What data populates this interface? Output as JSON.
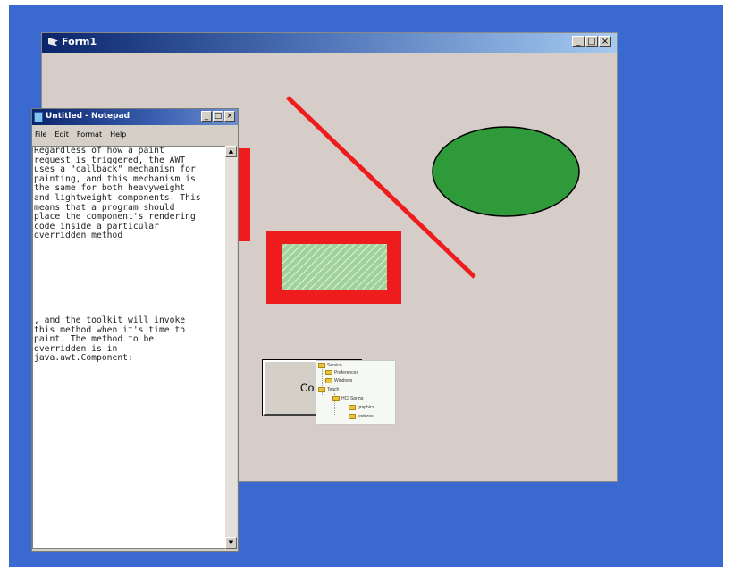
{
  "form1": {
    "title": "Form1",
    "buttons": {
      "minimize": "_",
      "maximize": "□",
      "close": "×"
    },
    "command_button_label": "Co",
    "shape_colors": {
      "red": "#ee1c1c",
      "green": "#2e9a3a",
      "hatch": "#9fd39a"
    }
  },
  "tree": {
    "items": [
      "Service",
      "Preferences",
      "Windows",
      "Teach",
      "HCI Spring",
      "graphics",
      "lectures"
    ]
  },
  "notepad": {
    "title": "Untitled - Notepad",
    "buttons": {
      "minimize": "_",
      "maximize": "□",
      "close": "×"
    },
    "menu": [
      "File",
      "Edit",
      "Format",
      "Help"
    ],
    "paragraph1": "Regardless of how a paint\nrequest is triggered, the AWT\nuses a \"callback\" mechanism for\npainting, and this mechanism is\nthe same for both heavyweight\nand lightweight components. This\nmeans that a program should\nplace the component's rendering\ncode inside a particular\noverridden method",
    "paragraph2": ", and the toolkit will invoke\nthis method when it's time to\npaint. The method to be\noverridden is in\njava.awt.Component:",
    "scroll_up": "▲",
    "scroll_down": "▼"
  }
}
